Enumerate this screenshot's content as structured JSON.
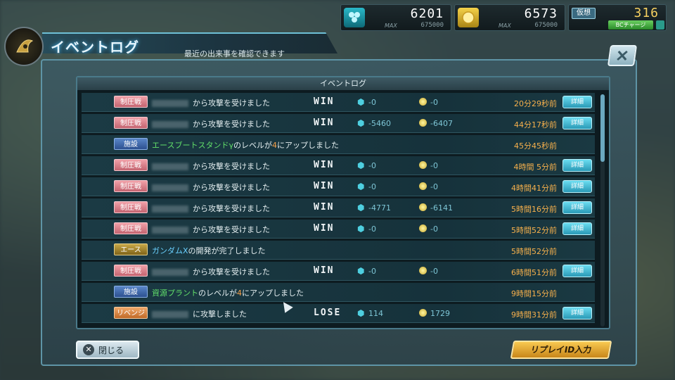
{
  "resources": {
    "parts": {
      "icon": "hex-cluster-icon",
      "value": "6201",
      "max_label": "MAX",
      "max": "675000"
    },
    "coins": {
      "icon": "coin-icon",
      "value": "6573",
      "max_label": "MAX",
      "max": "675000"
    },
    "virtual": {
      "label": "仮想",
      "value": "316",
      "charge_label": "BCチャージ"
    }
  },
  "header": {
    "title": "イベントログ",
    "subtitle": "最近の出来事を確認できます"
  },
  "list": {
    "header": "イベントログ",
    "detail_label": "詳細",
    "rows": [
      {
        "tag": "制圧戦",
        "tag_type": "seiatsu",
        "msg": "から攻撃を受けました",
        "result": "WIN",
        "parts": "-0",
        "coins": "-0",
        "time": "20分29秒前",
        "detail": true
      },
      {
        "tag": "制圧戦",
        "tag_type": "seiatsu",
        "msg": "から攻撃を受けました",
        "result": "WIN",
        "parts": "-5460",
        "coins": "-6407",
        "time": "44分17秒前",
        "detail": true
      },
      {
        "tag": "施設",
        "tag_type": "shisetsu",
        "msg_a": "エースブートスタンドγ",
        "msg_b": "のレベルが",
        "msg_c": "4",
        "msg_d": "にアップしました",
        "time": "45分45秒前",
        "detail": false
      },
      {
        "tag": "制圧戦",
        "tag_type": "seiatsu",
        "msg": "から攻撃を受けました",
        "result": "WIN",
        "parts": "-0",
        "coins": "-0",
        "time": "4時間 5分前",
        "detail": true
      },
      {
        "tag": "制圧戦",
        "tag_type": "seiatsu",
        "msg": "から攻撃を受けました",
        "result": "WIN",
        "parts": "-0",
        "coins": "-0",
        "time": "4時間41分前",
        "detail": true
      },
      {
        "tag": "制圧戦",
        "tag_type": "seiatsu",
        "msg": "から攻撃を受けました",
        "result": "WIN",
        "parts": "-4771",
        "coins": "-6141",
        "time": "5時間16分前",
        "detail": true
      },
      {
        "tag": "制圧戦",
        "tag_type": "seiatsu",
        "msg": "から攻撃を受けました",
        "result": "WIN",
        "parts": "-0",
        "coins": "-0",
        "time": "5時間52分前",
        "detail": true
      },
      {
        "tag": "エース",
        "tag_type": "ace",
        "msg_a": "ガンダムX",
        "msg_b": "の開発が完了しました",
        "time": "5時間52分前",
        "detail": false
      },
      {
        "tag": "制圧戦",
        "tag_type": "seiatsu",
        "msg": "から攻撃を受けました",
        "result": "WIN",
        "parts": "-0",
        "coins": "-0",
        "time": "6時間51分前",
        "detail": true
      },
      {
        "tag": "施設",
        "tag_type": "shisetsu",
        "msg_a": "資源プラント",
        "msg_b": "のレベルが",
        "msg_c": "4",
        "msg_d": "にアップしました",
        "time": "9時間15分前",
        "detail": false
      },
      {
        "tag": "リベンジ",
        "tag_type": "revenge",
        "msg": "に攻撃しました",
        "result": "LOSE",
        "parts": "114",
        "coins": "1729",
        "time": "9時間31分前",
        "detail": true
      }
    ]
  },
  "footer": {
    "close_label": "閉じる",
    "replay_label": "リプレイID入力"
  }
}
